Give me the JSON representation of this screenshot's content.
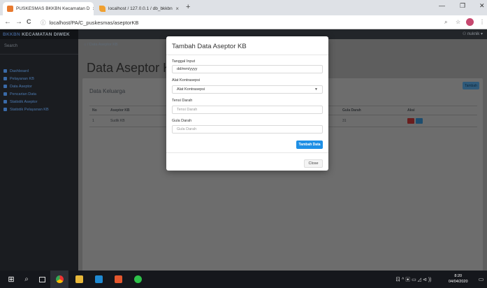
{
  "browser": {
    "tabs": [
      {
        "title": "PUSKESMAS BKKBN Kecamatan D",
        "close": "×"
      },
      {
        "title": "localhost / 127.0.0.1 / db_bkkbn",
        "close": "×"
      }
    ],
    "new_tab": "+",
    "window_controls": {
      "minimize": "—",
      "maximize": "❐",
      "close": "✕"
    },
    "nav": {
      "back": "←",
      "forward": "→",
      "reload": "C"
    },
    "url": "localhost/PA/C_puskesmas/aseptorKB",
    "url_info": "ⓘ"
  },
  "app": {
    "brand_prefix": "BKKBN",
    "brand_suffix": " KECAMATAN DIWEK",
    "user": "⚇ nuknik ▾",
    "search_label": "Search",
    "nav_items": [
      {
        "label": "Dashboard",
        "icon": "dashboard-icon"
      },
      {
        "label": "Pelayanan KB",
        "icon": "service-icon"
      },
      {
        "label": "Data Aseptor",
        "icon": "data-icon"
      },
      {
        "label": "Pencarian Data",
        "icon": "search-icon"
      },
      {
        "label": "Statistik Aseptor",
        "icon": "chart-icon"
      },
      {
        "label": "Statistik Pelayanan KB",
        "icon": "chart-icon"
      }
    ],
    "breadcrumb": "⌂ / Data Aseptor KB",
    "page_title": "Data Aseptor KB",
    "card_title": "Data Keluarga",
    "add_button": "Tambah",
    "table": {
      "headers": [
        "No",
        "Aseptor KB",
        "",
        "",
        "",
        "Gula Darah",
        "Aksi"
      ],
      "rows": [
        [
          "1",
          "Sudik KB",
          "",
          "",
          "",
          "31",
          ""
        ]
      ]
    }
  },
  "modal": {
    "title": "Tambah Data Aseptor KB",
    "fields": {
      "tanggal_label": "Tanggal Input",
      "tanggal_value": "dd/mm/yyyy",
      "alat_label": "Alat Kontrasepsi",
      "alat_value": "Alat Kontrasepsi",
      "tensi_label": "Tensi Darah",
      "tensi_placeholder": "Tensi Darah",
      "gula_label": "Gula Darah",
      "gula_placeholder": "Gula Darah"
    },
    "submit_button": "Tambah Data",
    "close_button": "Close"
  },
  "taskbar": {
    "start": "⊞",
    "search": "⌕",
    "time": "8:20",
    "date": "04/04/2020",
    "tray_text": "ㄖ ^ ▣ ▭ ◿ ⊲ ))"
  },
  "colors": {
    "submit_blue": "#1e8fe5",
    "sidebar_dark": "#1a1c20",
    "overlay": "#5e5e5e"
  }
}
